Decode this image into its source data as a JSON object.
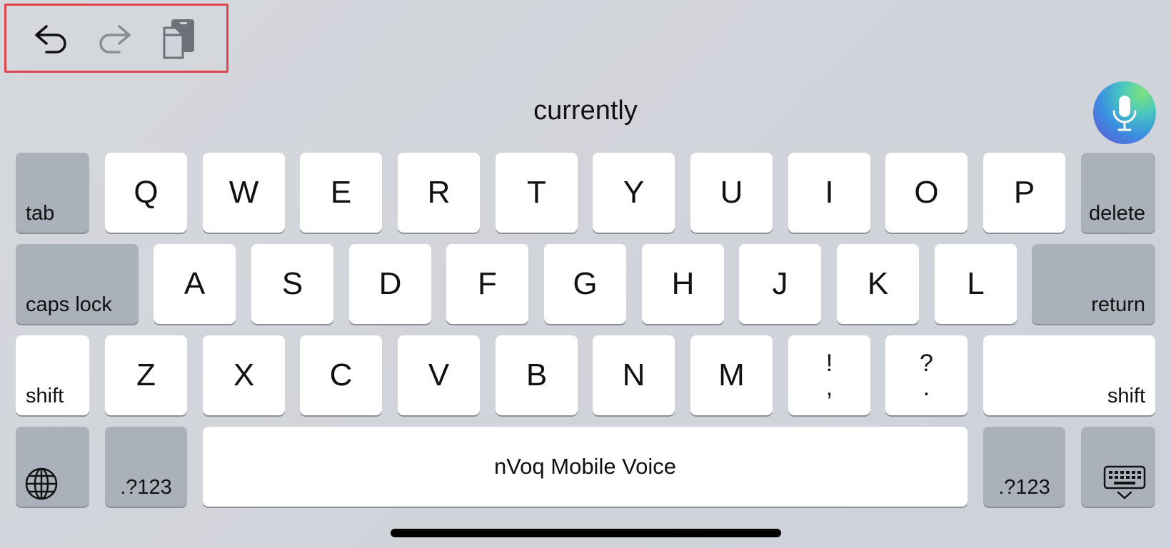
{
  "toolbar": {
    "undo_icon": "undo-arrow-icon",
    "redo_icon": "redo-arrow-icon",
    "paste_icon": "clipboard-paste-icon",
    "highlight_color": "#e0444c"
  },
  "suggestion": "currently",
  "mic_icon": "microphone-icon",
  "keys": {
    "tab": "tab",
    "delete": "delete",
    "caps_lock": "caps lock",
    "return": "return",
    "shift_left": "shift",
    "shift_right": "shift",
    "row1": [
      "Q",
      "W",
      "E",
      "R",
      "T",
      "Y",
      "U",
      "I",
      "O",
      "P"
    ],
    "row2": [
      "A",
      "S",
      "D",
      "F",
      "G",
      "H",
      "J",
      "K",
      "L"
    ],
    "row3": [
      "Z",
      "X",
      "C",
      "V",
      "B",
      "N",
      "M"
    ],
    "punct1": {
      "top": "!",
      "bottom": ","
    },
    "punct2": {
      "top": "?",
      "bottom": "."
    },
    "numbers_left": ".?123",
    "numbers_right": ".?123",
    "space": "nVoq Mobile Voice",
    "globe_icon": "globe-icon",
    "dismiss_icon": "keyboard-dismiss-icon"
  }
}
